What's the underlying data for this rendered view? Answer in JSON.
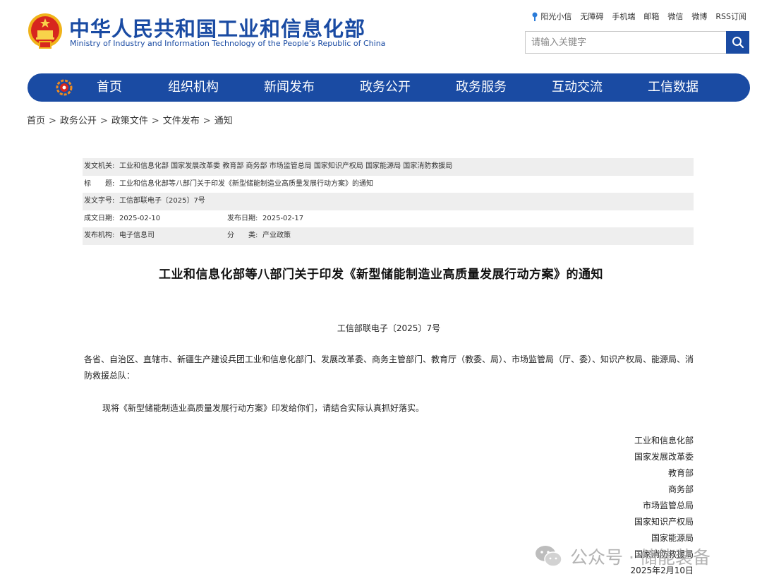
{
  "header": {
    "brand_cn": "中华人民共和国工业和信息化部",
    "brand_en": "Ministry of Industry and Information Technology of the People’s Republic of China",
    "logo_icon": "national-emblem-icon"
  },
  "top_links": [
    "阳光小信",
    "无障碍",
    "手机端",
    "邮箱",
    "微信",
    "微博",
    "RSS订阅"
  ],
  "search": {
    "placeholder": "请输入关键字",
    "icon": "search-icon"
  },
  "nav": {
    "logo_icon": "miit-logo-icon",
    "items": [
      "首页",
      "组织机构",
      "新闻发布",
      "政务公开",
      "政务服务",
      "互动交流",
      "工信数据"
    ]
  },
  "breadcrumb": [
    "首页",
    "政务公开",
    "政策文件",
    "文件发布",
    "通知"
  ],
  "breadcrumb_sep": ">",
  "meta": {
    "issuer_label": "发文机关:",
    "issuer_value": "工业和信息化部 国家发展改革委 教育部 商务部 市场监管总局 国家知识产权局 国家能源局 国家消防救援局",
    "title_label": "标　　题:",
    "title_value": "工业和信息化部等八部门关于印发《新型储能制造业高质量发展行动方案》的通知",
    "doc_no_label": "发文字号:",
    "doc_no_value": "工信部联电子〔2025〕7号",
    "created_label": "成文日期:",
    "created_value": "2025-02-10",
    "published_label": "发布日期:",
    "published_value": "2025-02-17",
    "org_label": "发布机构:",
    "org_value": "电子信息司",
    "category_label": "分　　类:",
    "category_value": "产业政策"
  },
  "article": {
    "title": "工业和信息化部等八部门关于印发《新型储能制造业高质量发展行动方案》的通知",
    "doc_number": "工信部联电子〔2025〕7号",
    "recipients": "各省、自治区、直辖市、新疆生产建设兵团工业和信息化部门、发展改革委、商务主管部门、教育厅（教委、局）、市场监管局（厅、委）、知识产权局、能源局、消防救援总队：",
    "body": "现将《新型储能制造业高质量发展行动方案》印发给你们，请结合实际认真抓好落实。",
    "signatories": [
      "工业和信息化部",
      "国家发展改革委",
      "教育部",
      "商务部",
      "市场监管总局",
      "国家知识产权局",
      "国家能源局",
      "国家消防救援局"
    ],
    "date": "2025年2月10日"
  },
  "watermark": {
    "text": "公众号 · 储能装备",
    "icon": "wechat-icon"
  },
  "colors": {
    "brand_blue": "#1a4ba3",
    "table_shade": "#eeeeee",
    "logo_red": "#d7261e",
    "logo_gold": "#f0b31a"
  }
}
